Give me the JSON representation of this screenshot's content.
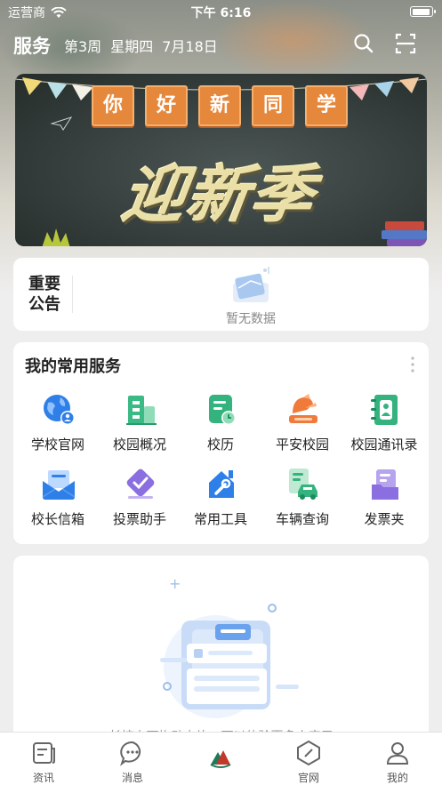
{
  "status_bar": {
    "carrier": "运营商",
    "time": "下午 6:16"
  },
  "header": {
    "title": "服务",
    "week": "第3周",
    "weekday": "星期四",
    "date": "7月18日"
  },
  "banner": {
    "signs": [
      "你",
      "好",
      "新",
      "同",
      "学"
    ],
    "headline": "迎新季"
  },
  "notice": {
    "label": "重要公告",
    "empty_text": "暂无数据"
  },
  "services": {
    "title": "我的常用服务",
    "items": [
      {
        "label": "学校官网",
        "icon": "globe-user-icon"
      },
      {
        "label": "校园概况",
        "icon": "building-icon"
      },
      {
        "label": "校历",
        "icon": "calendar-doc-icon"
      },
      {
        "label": "平安校园",
        "icon": "safe-campus-icon"
      },
      {
        "label": "校园通讯录",
        "icon": "contacts-book-icon"
      },
      {
        "label": "校长信箱",
        "icon": "mailbox-icon"
      },
      {
        "label": "投票助手",
        "icon": "vote-check-icon"
      },
      {
        "label": "常用工具",
        "icon": "toolbox-icon"
      },
      {
        "label": "车辆查询",
        "icon": "car-query-icon"
      },
      {
        "label": "发票夹",
        "icon": "invoice-folder-icon"
      }
    ]
  },
  "panel": {
    "hint": "长按上下拖动卡片，可以体验更多小应用"
  },
  "tabbar": {
    "items": [
      {
        "label": "资讯",
        "icon": "news-icon"
      },
      {
        "label": "消息",
        "icon": "message-icon"
      },
      {
        "label": "",
        "icon": "home-logo-icon"
      },
      {
        "label": "官网",
        "icon": "website-icon"
      },
      {
        "label": "我的",
        "icon": "profile-icon"
      }
    ]
  },
  "colors": {
    "accent_blue": "#2f7fe8",
    "accent_green": "#34b37e",
    "accent_orange": "#f07a3a",
    "accent_purple": "#8b6fe0"
  }
}
